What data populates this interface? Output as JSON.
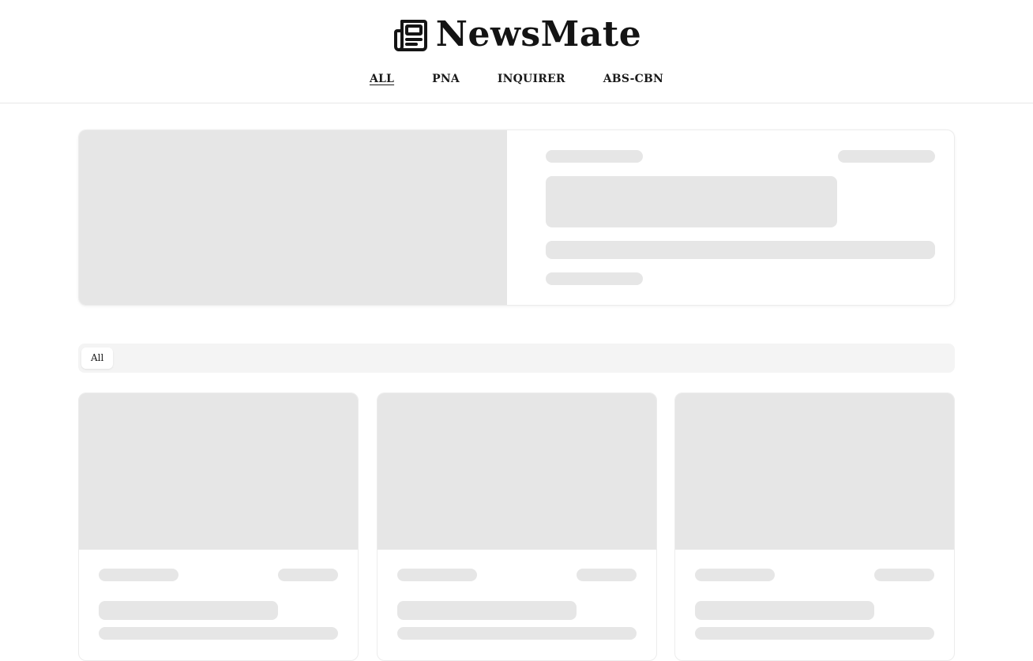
{
  "brand": {
    "title": "NewsMate",
    "icon": "newspaper-icon"
  },
  "nav": {
    "items": [
      {
        "label": "ALL",
        "active": true
      },
      {
        "label": "PNA",
        "active": false
      },
      {
        "label": "INQUIRER",
        "active": false
      },
      {
        "label": "ABS-CBN",
        "active": false
      }
    ]
  },
  "filter": {
    "selected_label": "All"
  },
  "colors": {
    "skeleton": "#e6e6e6",
    "filter_bar": "#f4f4f4",
    "border": "#ececec",
    "text": "#1a1a1a"
  },
  "loading_state": true
}
